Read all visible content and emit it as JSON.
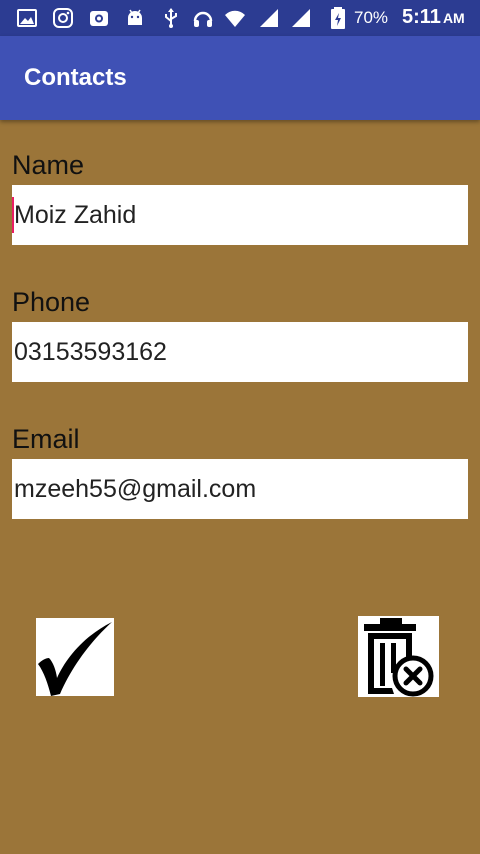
{
  "status_bar": {
    "icons": [
      "image-icon",
      "instagram-icon",
      "camera-icon",
      "android-icon",
      "usb-icon",
      "headset-icon",
      "wifi-icon",
      "signal-icon",
      "signal-icon",
      "battery-icon"
    ],
    "battery": "70%",
    "time": "5:11",
    "ampm": "AM"
  },
  "app_bar": {
    "title": "Contacts"
  },
  "form": {
    "name_label": "Name",
    "name_value": "Moiz Zahid",
    "phone_label": "Phone",
    "phone_value": "03153593162",
    "email_label": "Email",
    "email_value": "mzeeh55@gmail.com"
  },
  "actions": {
    "confirm_icon": "checkmark-icon",
    "delete_icon": "delete-contact-icon"
  },
  "colors": {
    "status_bar": "#2c3c92",
    "app_bar": "#3f51b5",
    "background": "#9b7539",
    "cursor": "#e91e63"
  }
}
